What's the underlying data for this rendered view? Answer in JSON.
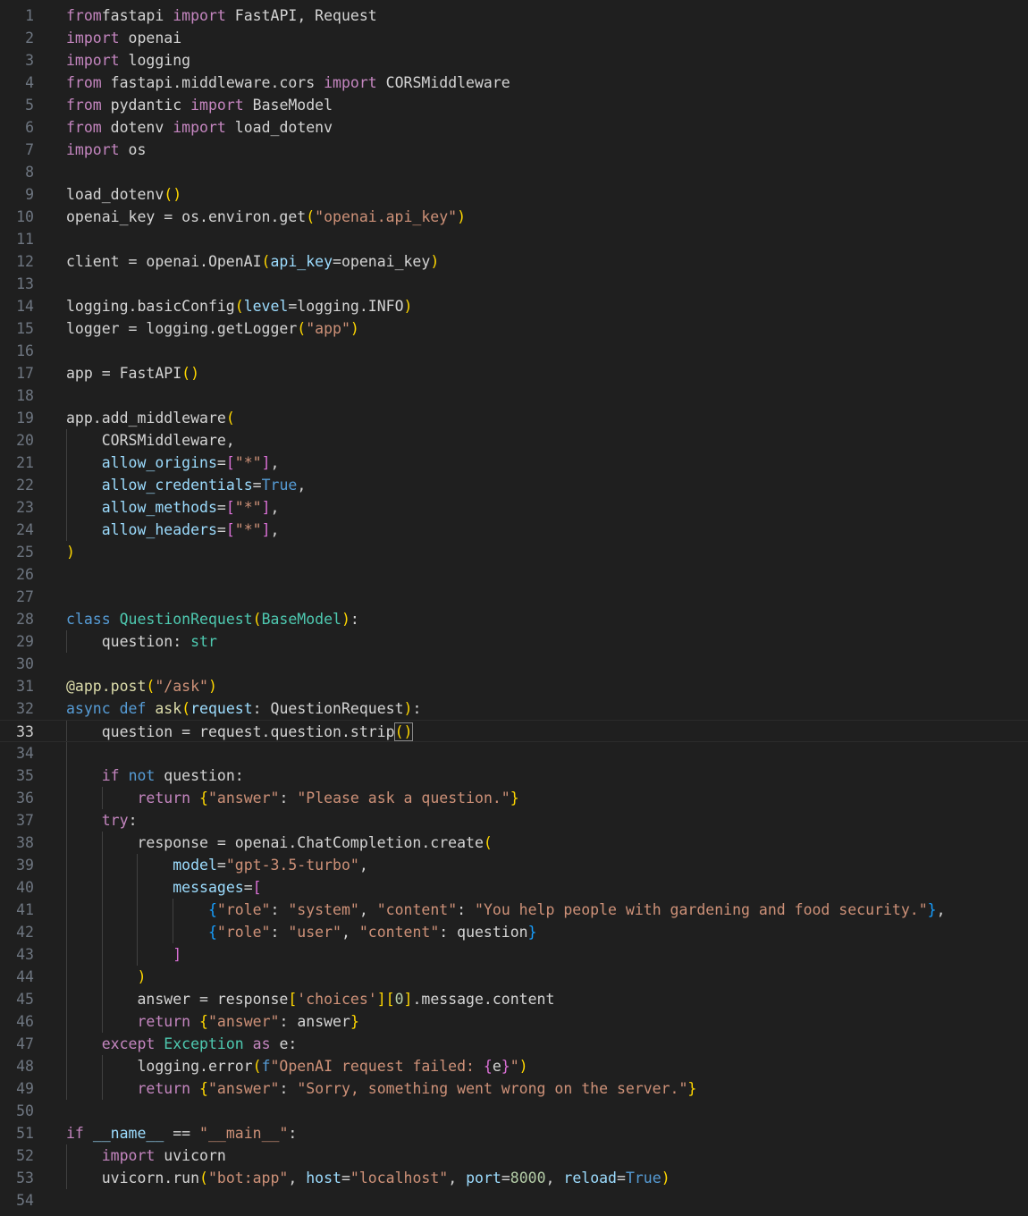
{
  "editor": {
    "language": "python",
    "current_line": 33,
    "colors": {
      "background": "#1f1f1f",
      "keyword_control": "#c586c0",
      "keyword_storage": "#569cd6",
      "function": "#dcdcaa",
      "class": "#4ec9b0",
      "string": "#ce9178",
      "parameter": "#9cdcfe",
      "number": "#b5cea8",
      "bracket_1": "#ffd700",
      "bracket_2": "#da70d6",
      "bracket_3": "#179fff"
    },
    "lines": [
      {
        "n": "1",
        "t": [
          [
            "kw",
            "from"
          ],
          [
            "",
            "fastapi "
          ],
          [
            "kw",
            "import"
          ],
          [
            "",
            " FastAPI, Request"
          ]
        ]
      },
      {
        "n": "2",
        "t": [
          [
            "kw",
            "import"
          ],
          [
            "",
            " openai"
          ]
        ]
      },
      {
        "n": "3",
        "t": [
          [
            "kw",
            "import"
          ],
          [
            "",
            " logging"
          ]
        ]
      },
      {
        "n": "4",
        "t": [
          [
            "kw",
            "from"
          ],
          [
            "",
            " fastapi.middleware.cors "
          ],
          [
            "kw",
            "import"
          ],
          [
            "",
            " CORSMiddleware"
          ]
        ]
      },
      {
        "n": "5",
        "t": [
          [
            "kw",
            "from"
          ],
          [
            "",
            " pydantic "
          ],
          [
            "kw",
            "import"
          ],
          [
            "",
            " BaseModel"
          ]
        ]
      },
      {
        "n": "6",
        "t": [
          [
            "kw",
            "from"
          ],
          [
            "",
            " dotenv "
          ],
          [
            "kw",
            "import"
          ],
          [
            "",
            " load_dotenv"
          ]
        ]
      },
      {
        "n": "7",
        "t": [
          [
            "kw",
            "import"
          ],
          [
            "",
            " os"
          ]
        ]
      },
      {
        "n": "8",
        "t": []
      },
      {
        "n": "9",
        "t": [
          [
            "",
            "load_dotenv"
          ],
          [
            "b1",
            "()"
          ]
        ]
      },
      {
        "n": "10",
        "t": [
          [
            "",
            "openai_key = os.environ.get"
          ],
          [
            "b1",
            "("
          ],
          [
            "str",
            "\"openai.api_key\""
          ],
          [
            "b1",
            ")"
          ]
        ]
      },
      {
        "n": "11",
        "t": []
      },
      {
        "n": "12",
        "t": [
          [
            "",
            "client = openai.OpenAI"
          ],
          [
            "b1",
            "("
          ],
          [
            "par",
            "api_key"
          ],
          [
            "",
            "=openai_key"
          ],
          [
            "b1",
            ")"
          ]
        ]
      },
      {
        "n": "13",
        "t": []
      },
      {
        "n": "14",
        "t": [
          [
            "",
            "logging.basicConfig"
          ],
          [
            "b1",
            "("
          ],
          [
            "par",
            "level"
          ],
          [
            "",
            "=logging.INFO"
          ],
          [
            "b1",
            ")"
          ]
        ]
      },
      {
        "n": "15",
        "t": [
          [
            "",
            "logger = logging.getLogger"
          ],
          [
            "b1",
            "("
          ],
          [
            "str",
            "\"app\""
          ],
          [
            "b1",
            ")"
          ]
        ]
      },
      {
        "n": "16",
        "t": []
      },
      {
        "n": "17",
        "t": [
          [
            "",
            "app = FastAPI"
          ],
          [
            "b1",
            "()"
          ]
        ]
      },
      {
        "n": "18",
        "t": []
      },
      {
        "n": "19",
        "t": [
          [
            "",
            "app.add_middleware"
          ],
          [
            "b1",
            "("
          ]
        ]
      },
      {
        "n": "20",
        "t": [
          [
            "",
            "    CORSMiddleware,"
          ]
        ]
      },
      {
        "n": "21",
        "t": [
          [
            "",
            "    "
          ],
          [
            "par",
            "allow_origins"
          ],
          [
            "",
            "="
          ],
          [
            "b2",
            "["
          ],
          [
            "str",
            "\"*\""
          ],
          [
            "b2",
            "]"
          ],
          [
            "",
            ","
          ]
        ]
      },
      {
        "n": "22",
        "t": [
          [
            "",
            "    "
          ],
          [
            "par",
            "allow_credentials"
          ],
          [
            "",
            "="
          ],
          [
            "kb",
            "True"
          ],
          [
            "",
            ","
          ]
        ]
      },
      {
        "n": "23",
        "t": [
          [
            "",
            "    "
          ],
          [
            "par",
            "allow_methods"
          ],
          [
            "",
            "="
          ],
          [
            "b2",
            "["
          ],
          [
            "str",
            "\"*\""
          ],
          [
            "b2",
            "]"
          ],
          [
            "",
            ","
          ]
        ]
      },
      {
        "n": "24",
        "t": [
          [
            "",
            "    "
          ],
          [
            "par",
            "allow_headers"
          ],
          [
            "",
            "="
          ],
          [
            "b2",
            "["
          ],
          [
            "str",
            "\"*\""
          ],
          [
            "b2",
            "]"
          ],
          [
            "",
            ","
          ]
        ]
      },
      {
        "n": "25",
        "t": [
          [
            "b1",
            ")"
          ]
        ]
      },
      {
        "n": "26",
        "t": []
      },
      {
        "n": "27",
        "t": []
      },
      {
        "n": "28",
        "t": [
          [
            "kb",
            "class"
          ],
          [
            "",
            " "
          ],
          [
            "cls",
            "QuestionRequest"
          ],
          [
            "b1",
            "("
          ],
          [
            "cls",
            "BaseModel"
          ],
          [
            "b1",
            ")"
          ],
          [
            "",
            ":"
          ]
        ]
      },
      {
        "n": "29",
        "t": [
          [
            "",
            "    question: "
          ],
          [
            "cls",
            "str"
          ]
        ]
      },
      {
        "n": "30",
        "t": []
      },
      {
        "n": "31",
        "t": [
          [
            "dec",
            "@app.post"
          ],
          [
            "b1",
            "("
          ],
          [
            "str",
            "\"/ask\""
          ],
          [
            "b1",
            ")"
          ]
        ]
      },
      {
        "n": "32",
        "t": [
          [
            "kb",
            "async"
          ],
          [
            "",
            " "
          ],
          [
            "kb",
            "def"
          ],
          [
            "",
            " "
          ],
          [
            "fn",
            "ask"
          ],
          [
            "b1",
            "("
          ],
          [
            "par",
            "request"
          ],
          [
            "",
            ": QuestionRequest"
          ],
          [
            "b1",
            ")"
          ],
          [
            "",
            ":"
          ]
        ]
      },
      {
        "n": "33",
        "t": [
          [
            "",
            "    question = request.question.strip"
          ],
          [
            "b1hl",
            "()"
          ]
        ]
      },
      {
        "n": "34",
        "t": []
      },
      {
        "n": "35",
        "t": [
          [
            "",
            "    "
          ],
          [
            "kw",
            "if"
          ],
          [
            "",
            " "
          ],
          [
            "kb",
            "not"
          ],
          [
            "",
            " question:"
          ]
        ]
      },
      {
        "n": "36",
        "t": [
          [
            "",
            "        "
          ],
          [
            "kw",
            "return"
          ],
          [
            "",
            " "
          ],
          [
            "b1",
            "{"
          ],
          [
            "str",
            "\"answer\""
          ],
          [
            "",
            ": "
          ],
          [
            "str",
            "\"Please ask a question.\""
          ],
          [
            "b1",
            "}"
          ]
        ]
      },
      {
        "n": "37",
        "t": [
          [
            "",
            "    "
          ],
          [
            "kw",
            "try"
          ],
          [
            "",
            ":"
          ]
        ]
      },
      {
        "n": "38",
        "t": [
          [
            "",
            "        response = openai.ChatCompletion.create"
          ],
          [
            "b1",
            "("
          ]
        ]
      },
      {
        "n": "39",
        "t": [
          [
            "",
            "            "
          ],
          [
            "par",
            "model"
          ],
          [
            "",
            "="
          ],
          [
            "str",
            "\"gpt-3.5-turbo\""
          ],
          [
            "",
            ","
          ]
        ]
      },
      {
        "n": "40",
        "t": [
          [
            "",
            "            "
          ],
          [
            "par",
            "messages"
          ],
          [
            "",
            "="
          ],
          [
            "b2",
            "["
          ]
        ]
      },
      {
        "n": "41",
        "t": [
          [
            "",
            "                "
          ],
          [
            "b3",
            "{"
          ],
          [
            "str",
            "\"role\""
          ],
          [
            "",
            ": "
          ],
          [
            "str",
            "\"system\""
          ],
          [
            "",
            ", "
          ],
          [
            "str",
            "\"content\""
          ],
          [
            "",
            ": "
          ],
          [
            "str",
            "\"You help people with gardening and food security.\""
          ],
          [
            "b3",
            "}"
          ],
          [
            "",
            ","
          ]
        ]
      },
      {
        "n": "42",
        "t": [
          [
            "",
            "                "
          ],
          [
            "b3",
            "{"
          ],
          [
            "str",
            "\"role\""
          ],
          [
            "",
            ": "
          ],
          [
            "str",
            "\"user\""
          ],
          [
            "",
            ", "
          ],
          [
            "str",
            "\"content\""
          ],
          [
            "",
            ": question"
          ],
          [
            "b3",
            "}"
          ]
        ]
      },
      {
        "n": "43",
        "t": [
          [
            "",
            "            "
          ],
          [
            "b2",
            "]"
          ]
        ]
      },
      {
        "n": "44",
        "t": [
          [
            "",
            "        "
          ],
          [
            "b1",
            ")"
          ]
        ]
      },
      {
        "n": "45",
        "t": [
          [
            "",
            "        answer = response"
          ],
          [
            "b1",
            "["
          ],
          [
            "str",
            "'choices'"
          ],
          [
            "b1",
            "]["
          ],
          [
            "num",
            "0"
          ],
          [
            "b1",
            "]"
          ],
          [
            "",
            ".message.content"
          ]
        ]
      },
      {
        "n": "46",
        "t": [
          [
            "",
            "        "
          ],
          [
            "kw",
            "return"
          ],
          [
            "",
            " "
          ],
          [
            "b1",
            "{"
          ],
          [
            "str",
            "\"answer\""
          ],
          [
            "",
            ": answer"
          ],
          [
            "b1",
            "}"
          ]
        ]
      },
      {
        "n": "47",
        "t": [
          [
            "",
            "    "
          ],
          [
            "kw",
            "except"
          ],
          [
            "",
            " "
          ],
          [
            "cls",
            "Exception"
          ],
          [
            "",
            " "
          ],
          [
            "kw",
            "as"
          ],
          [
            "",
            " e:"
          ]
        ]
      },
      {
        "n": "48",
        "t": [
          [
            "",
            "        logging.error"
          ],
          [
            "b1",
            "("
          ],
          [
            "kb",
            "f"
          ],
          [
            "str",
            "\"OpenAI request failed: "
          ],
          [
            "b2",
            "{"
          ],
          [
            "",
            "e"
          ],
          [
            "b2",
            "}"
          ],
          [
            "str",
            "\""
          ],
          [
            "b1",
            ")"
          ]
        ]
      },
      {
        "n": "49",
        "t": [
          [
            "",
            "        "
          ],
          [
            "kw",
            "return"
          ],
          [
            "",
            " "
          ],
          [
            "b1",
            "{"
          ],
          [
            "str",
            "\"answer\""
          ],
          [
            "",
            ": "
          ],
          [
            "str",
            "\"Sorry, something went wrong on the server.\""
          ],
          [
            "b1",
            "}"
          ]
        ]
      },
      {
        "n": "50",
        "t": []
      },
      {
        "n": "51",
        "t": [
          [
            "kw",
            "if"
          ],
          [
            "",
            " "
          ],
          [
            "par",
            "__name__"
          ],
          [
            "",
            " == "
          ],
          [
            "str",
            "\"__main__\""
          ],
          [
            "",
            ":"
          ]
        ]
      },
      {
        "n": "52",
        "t": [
          [
            "",
            "    "
          ],
          [
            "kw",
            "import"
          ],
          [
            "",
            " uvicorn"
          ]
        ]
      },
      {
        "n": "53",
        "t": [
          [
            "",
            "    uvicorn.run"
          ],
          [
            "b1",
            "("
          ],
          [
            "str",
            "\"bot:app\""
          ],
          [
            "",
            ", "
          ],
          [
            "par",
            "host"
          ],
          [
            "",
            "="
          ],
          [
            "str",
            "\"localhost\""
          ],
          [
            "",
            ", "
          ],
          [
            "par",
            "port"
          ],
          [
            "",
            "="
          ],
          [
            "num",
            "8000"
          ],
          [
            "",
            ", "
          ],
          [
            "par",
            "reload"
          ],
          [
            "",
            "="
          ],
          [
            "kb",
            "True"
          ],
          [
            "b1",
            ")"
          ]
        ]
      },
      {
        "n": "54",
        "t": []
      }
    ]
  }
}
